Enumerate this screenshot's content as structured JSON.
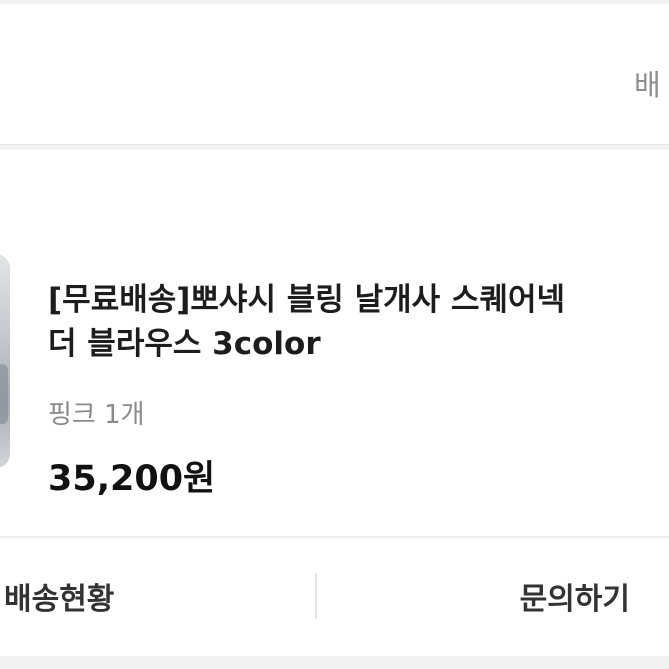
{
  "header": {
    "right_label": "배"
  },
  "order": {
    "title_line1": "[무료배송]뽀샤시 블링 날개사 스퀘어넥",
    "title_line2": "더 블라우스 3color",
    "option": "핑크 1개",
    "price": "35,200원"
  },
  "actions": {
    "delivery_label": "배송현황",
    "inquiry_label": "문의하기"
  },
  "colors": {
    "background": "#f2f2f2",
    "card": "#ffffff",
    "text_primary": "#1d1d1f",
    "text_secondary": "#8a8a8a"
  }
}
